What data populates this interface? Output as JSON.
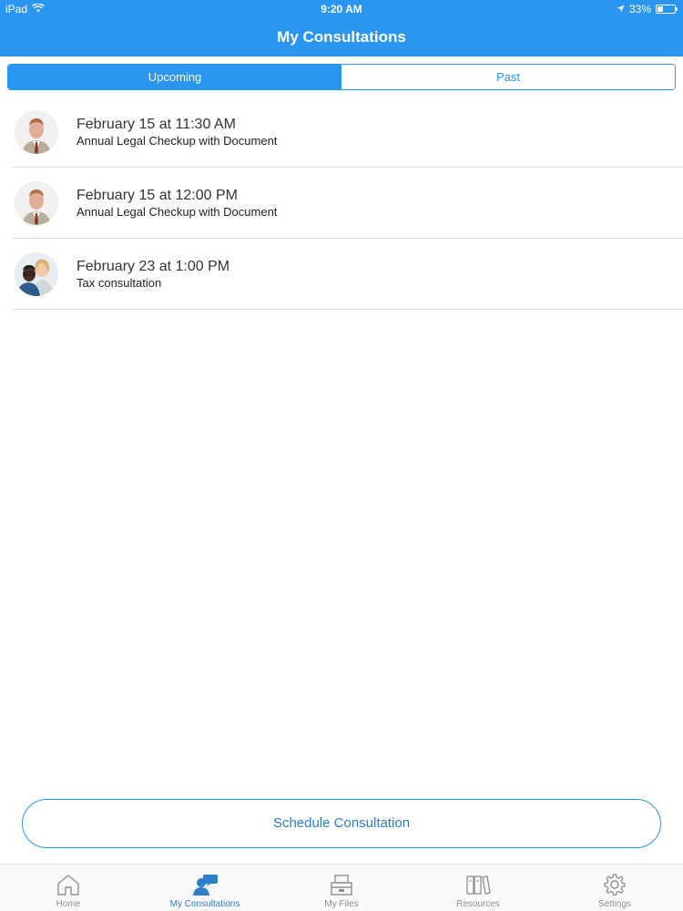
{
  "status_bar": {
    "device": "iPad",
    "time": "9:20 AM",
    "battery": "33%",
    "battery_level": 0.33
  },
  "header": {
    "title": "My Consultations"
  },
  "segments": [
    {
      "label": "Upcoming",
      "active": true
    },
    {
      "label": "Past",
      "active": false
    }
  ],
  "consultations": [
    {
      "date": "February 15 at 11:30 AM",
      "description": "Annual Legal Checkup with Document",
      "avatar": "lawyer-portrait"
    },
    {
      "date": "February 15 at 12:00 PM",
      "description": "Annual Legal Checkup with Document",
      "avatar": "lawyer-portrait"
    },
    {
      "date": "February 23 at 1:00 PM",
      "description": "Tax consultation",
      "avatar": "two-people-photo"
    }
  ],
  "schedule_button": {
    "label": "Schedule Consultation"
  },
  "tabs": [
    {
      "label": "Home",
      "icon": "home-icon",
      "active": false
    },
    {
      "label": "My Consultations",
      "icon": "consultations-icon",
      "active": true
    },
    {
      "label": "My Files",
      "icon": "files-icon",
      "active": false
    },
    {
      "label": "Resources",
      "icon": "resources-icon",
      "active": false
    },
    {
      "label": "Settings",
      "icon": "gear-icon",
      "active": false
    }
  ],
  "colors": {
    "accent": "#2b96ef",
    "tab_inactive": "#8e8e8e"
  }
}
